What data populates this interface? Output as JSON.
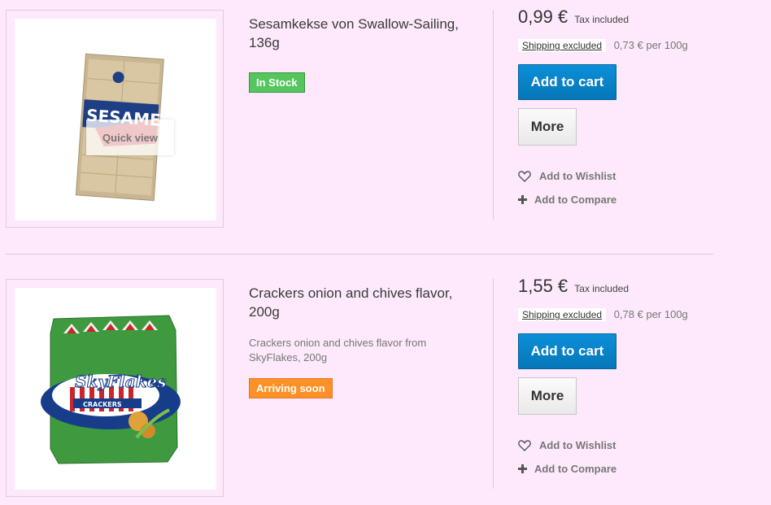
{
  "products": [
    {
      "name": "Sesamkekse von Swallow-Sailing, 136g",
      "description": "",
      "badge": "In Stock",
      "quick_view": "Quick view",
      "price": "0,99 €",
      "tax_note": "Tax included",
      "shipping": "Shipping excluded",
      "unit_price": "0,73 € per 100g",
      "add_to_cart": "Add to cart",
      "more": "More",
      "wishlist": "Add to Wishlist",
      "compare": "Add to Compare",
      "image_text": "SESAME"
    },
    {
      "name": "Crackers onion and chives flavor, 200g",
      "description": "Crackers onion and chives flavor from SkyFlakes, 200g",
      "badge": "Arriving soon",
      "price": "1,55 €",
      "tax_note": "Tax included",
      "shipping": "Shipping excluded",
      "unit_price": "0,78 € per 100g",
      "add_to_cart": "Add to cart",
      "more": "More",
      "wishlist": "Add to Wishlist",
      "compare": "Add to Compare",
      "image_text": "SkyFlakes",
      "image_subtext": "CRACKERS"
    }
  ],
  "colors": {
    "background": "#fde9fb",
    "in_stock": "#55c65e",
    "arriving_soon": "#fe9126",
    "cart_button": "#0b8fd8"
  }
}
